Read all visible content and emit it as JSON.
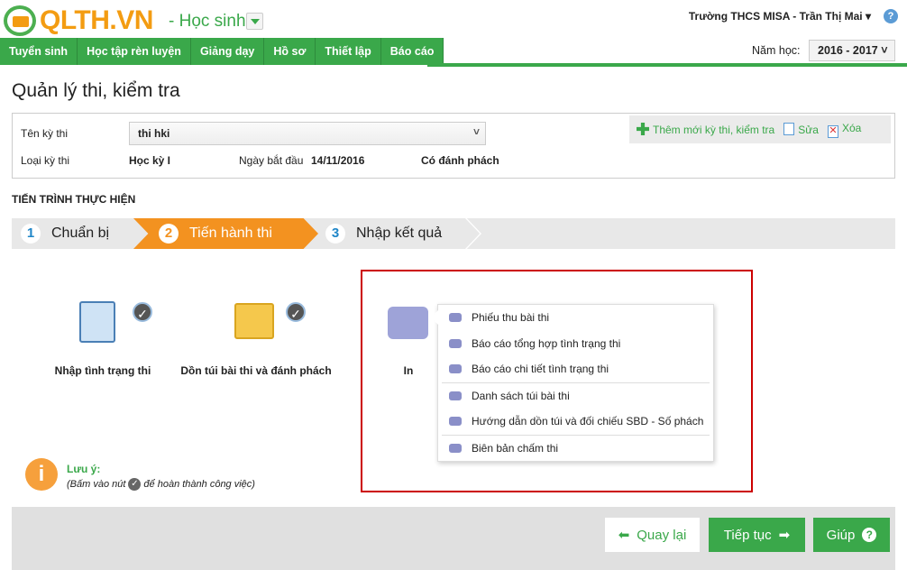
{
  "header": {
    "logo_text": "QLTH.VN",
    "role": "- Học sinh",
    "user": "Trường THCS MISA - Trần Thị Mai ▾"
  },
  "nav": [
    "Tuyển sinh",
    "Học tập rèn luyện",
    "Giảng dạy",
    "Hồ sơ",
    "Thiết lập",
    "Báo cáo"
  ],
  "year": {
    "label": "Năm học:",
    "value": "2016 - 2017 ˅"
  },
  "title": "Quản lý thi, kiểm tra",
  "exam": {
    "name_label": "Tên kỳ thi",
    "name_value": "thi hki",
    "type_label": "Loại kỳ thi",
    "type_value": "Học kỳ I",
    "date_label": "Ngày bắt đầu",
    "date_value": "14/11/2016",
    "phach": "Có đánh phách"
  },
  "actions": {
    "add": "Thêm mới kỳ thi, kiểm tra",
    "edit": "Sửa",
    "delete": "Xóa"
  },
  "section_title": "TIẾN TRÌNH THỰC HIỆN",
  "steps": [
    {
      "num": "1",
      "label": "Chuẩn bị"
    },
    {
      "num": "2",
      "label": "Tiến hành thi"
    },
    {
      "num": "3",
      "label": "Nhập kết quả"
    }
  ],
  "cards": {
    "c1": "Nhập tình trạng thi",
    "c2": "Dồn túi bài thi và đánh phách",
    "c3": "In"
  },
  "menu": [
    "Phiếu thu bài thi",
    "Báo cáo tổng hợp tình trạng thi",
    "Báo cáo chi tiết tình trạng thi",
    "Danh sách túi bài thi",
    "Hướng dẫn dồn túi và đối chiếu SBD - Số phách",
    "Biên bản chấm thi"
  ],
  "note": {
    "title": "Lưu ý:",
    "before": "(Bấm vào nút",
    "after": "để hoàn thành công việc)"
  },
  "buttons": {
    "back": "Quay lại",
    "next": "Tiếp tục",
    "help": "Giúp"
  }
}
